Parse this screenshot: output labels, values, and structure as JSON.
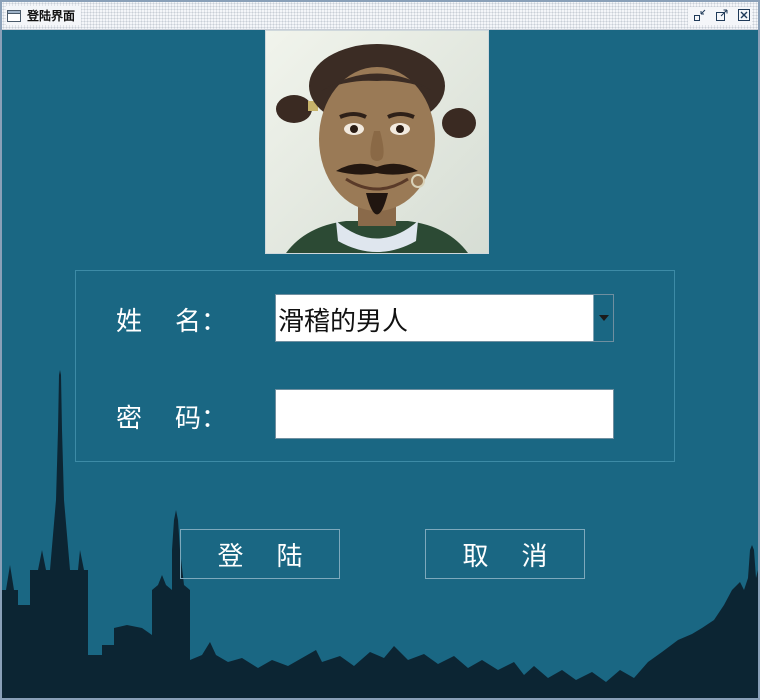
{
  "window": {
    "title": "登陆界面",
    "icon": "window-icon",
    "controls": [
      "minimize-icon",
      "maximize-icon",
      "close-icon"
    ]
  },
  "avatar": {
    "icon": "user-photo"
  },
  "form": {
    "username_label": "姓    名：",
    "username_value": "滑稽的男人",
    "password_label": "密    码：",
    "password_value": ""
  },
  "buttons": {
    "login": "登    陆",
    "cancel": "取    消"
  },
  "colors": {
    "background": "#1a6783",
    "skyline": "#0c2533",
    "text": "#ffffff"
  }
}
